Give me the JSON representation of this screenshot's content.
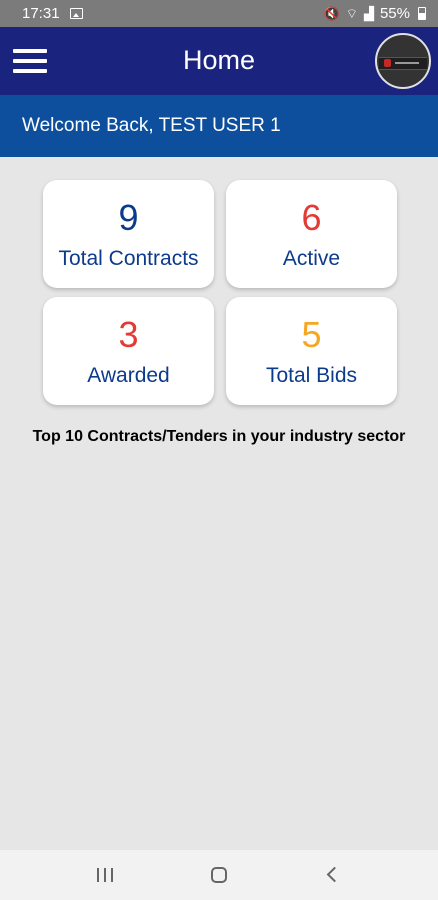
{
  "status_bar": {
    "time": "17:31",
    "battery": "55%"
  },
  "app_bar": {
    "title": "Home"
  },
  "welcome": {
    "text": "Welcome Back, TEST USER 1"
  },
  "stats": [
    {
      "value": "9",
      "label": "Total Contracts",
      "color": "#0d3b8c"
    },
    {
      "value": "6",
      "label": "Active",
      "color": "#e53935"
    },
    {
      "value": "3",
      "label": "Awarded",
      "color": "#e53935"
    },
    {
      "value": "5",
      "label": "Total Bids",
      "color": "#f5a623"
    }
  ],
  "section": {
    "heading": "Top 10 Contracts/Tenders in your industry sector"
  },
  "colors": {
    "app_bar": "#1a237e",
    "welcome_bar": "#0d4f9c",
    "background": "#e6e6e6"
  }
}
